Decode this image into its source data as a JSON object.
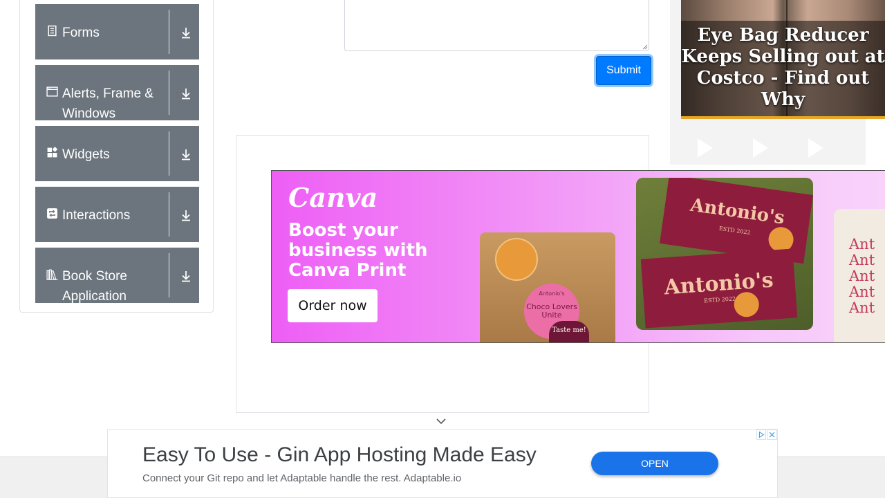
{
  "sidebar": {
    "groups": [
      {
        "label": "Forms",
        "icon": "document-icon"
      },
      {
        "label": "Alerts, Frame & Windows",
        "icon": "window-icon"
      },
      {
        "label": "Widgets",
        "icon": "widgets-icon"
      },
      {
        "label": "Interactions",
        "icon": "interactions-icon"
      },
      {
        "label": "Book Store Application",
        "icon": "book-icon"
      }
    ]
  },
  "form": {
    "submit_label": "Submit"
  },
  "right_ad": {
    "headline": "Eye Bag Reducer Keeps Selling out at Costco - Find out Why"
  },
  "canva_ad": {
    "logo": "Canva",
    "headline": "Boost your business with Canva Print",
    "cta": "Order now",
    "sticker_brand": "Antonio's",
    "sticker_text": "Choco Lovers Unite",
    "tag_text": "Taste me!",
    "card_brand": "Antonio's",
    "card_estd": "ESTD 2022",
    "tote_text": "Ant\nAnt\nAnt\nAnt\nAnt"
  },
  "bottom_ad": {
    "title": "Easy To Use - Gin App Hosting Made Easy",
    "subtitle": "Connect your Git repo and let Adaptable handle the rest. Adaptable.io",
    "open_label": "OPEN"
  },
  "colors": {
    "sidebar_group_bg": "#6c757d",
    "submit_bg": "#007bff",
    "open_button_bg": "#1a73e8",
    "canva_pink": "#ee5ef5"
  }
}
